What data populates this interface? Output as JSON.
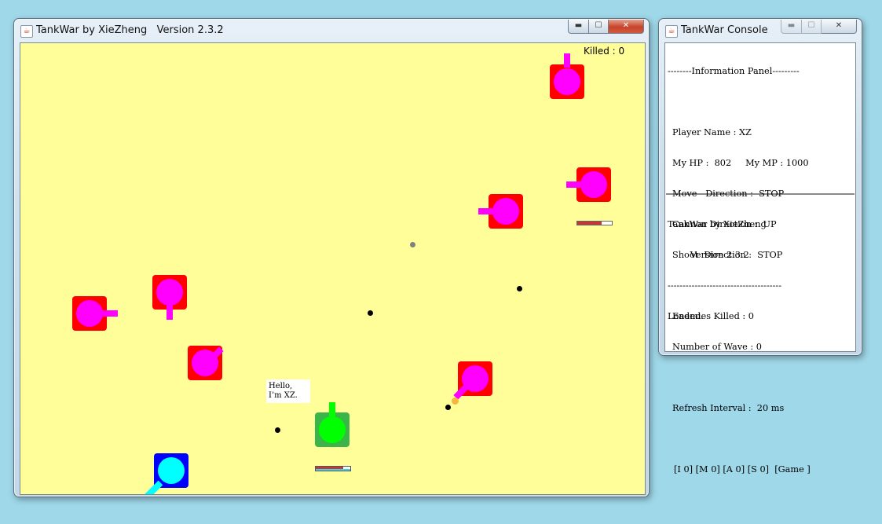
{
  "game_window": {
    "title": "TankWar by XieZheng   Version 2.3.2",
    "killed_label": "Killed : 0",
    "player_speech": "Hello,\nI’m XZ.",
    "player_hp_fraction": 0.8,
    "enemy_hp_fraction": 0.7
  },
  "console_window": {
    "title": "TankWar Console",
    "info_panel": {
      "header": "--------Information Panel---------",
      "player_name": "Player Name : XZ",
      "hp_mp": "My HP :  802     My MP : 1000",
      "move_direction": "Move   Direction :  STOP",
      "cannon_direction": "Cannon Direction :  UP",
      "shoot_direction": "Shoot  Direction :  STOP",
      "enemies_killed": "Enemies Killed : 0",
      "wave_number": "Number of Wave : 0",
      "refresh_interval": "Refresh Interval :  20 ms",
      "key_status": "[I 0] [M 0] [A 0] [S 0]  [Game ]"
    },
    "log_panel": {
      "line1": "TankWar by XieZheng",
      "line2": "        Version 2.3.2",
      "separator": "--------------------------------------",
      "line3": "Loaded."
    }
  },
  "colors": {
    "background": "#9fd8e9",
    "battlefield": "#fffe99",
    "enemy_tank": "#ff0000",
    "enemy_turret": "#ff00ff",
    "player_tank": "#3bb54a",
    "player_turret": "#00ff00",
    "ally_tank": "#0000ff",
    "ally_turret": "#00ffff"
  },
  "icons": {
    "app": "java-cup-icon",
    "minimize": "minimize-icon",
    "maximize": "maximize-icon",
    "close": "close-icon"
  }
}
